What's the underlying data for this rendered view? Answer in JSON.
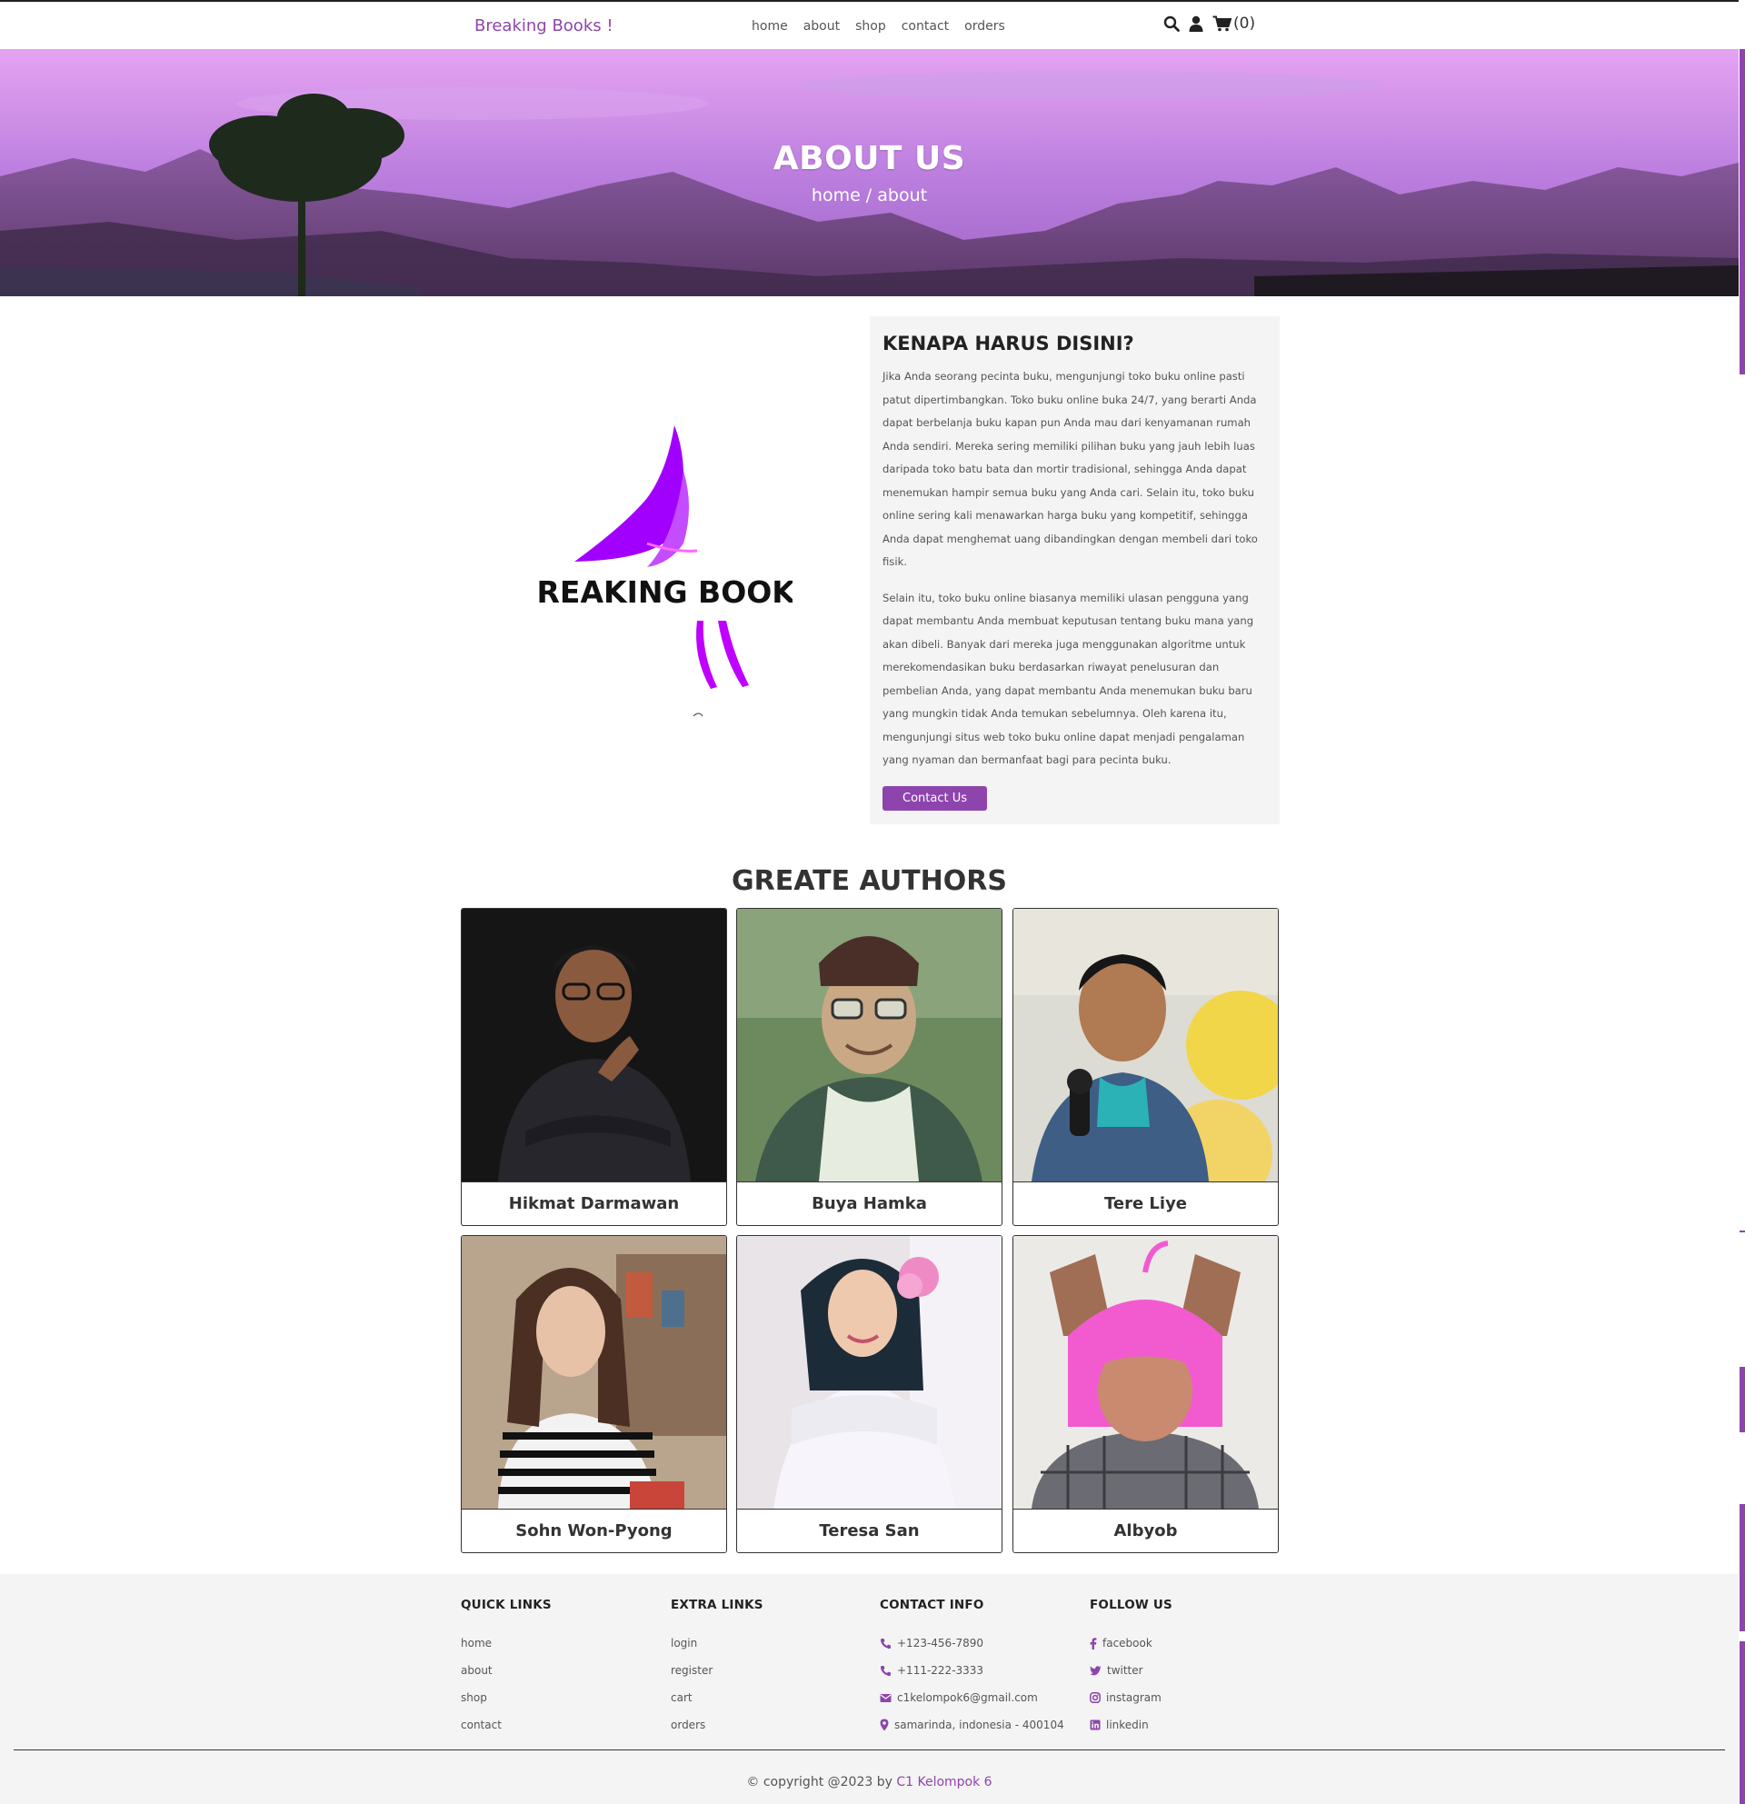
{
  "header": {
    "brand": "Breaking Books !",
    "nav": [
      "home",
      "about",
      "shop",
      "contact",
      "orders"
    ],
    "cart_count": "(0)",
    "icons": [
      "search-icon",
      "user-icon",
      "cart-icon"
    ]
  },
  "hero": {
    "title": "ABOUT US",
    "breadcrumb": "home / about"
  },
  "about": {
    "logo_text": "BREAKING BOOKS",
    "heading": "KENAPA HARUS DISINI?",
    "paragraph1": "Jika Anda seorang pecinta buku, mengunjungi toko buku online pasti patut dipertimbangkan. Toko buku online buka 24/7, yang berarti Anda dapat berbelanja buku kapan pun Anda mau dari kenyamanan rumah Anda sendiri. Mereka sering memiliki pilihan buku yang jauh lebih luas daripada toko batu bata dan mortir tradisional, sehingga Anda dapat menemukan hampir semua buku yang Anda cari. Selain itu, toko buku online sering kali menawarkan harga buku yang kompetitif, sehingga Anda dapat menghemat uang dibandingkan dengan membeli dari toko fisik.",
    "paragraph2": "Selain itu, toko buku online biasanya memiliki ulasan pengguna yang dapat membantu Anda membuat keputusan tentang buku mana yang akan dibeli. Banyak dari mereka juga menggunakan algoritme untuk merekomendasikan buku berdasarkan riwayat penelusuran dan pembelian Anda, yang dapat membantu Anda menemukan buku baru yang mungkin tidak Anda temukan sebelumnya. Oleh karena itu, mengunjungi situs web toko buku online dapat menjadi pengalaman yang nyaman dan bermanfaat bagi para pecinta buku.",
    "button": "Contact Us"
  },
  "authors": {
    "title": "GREATE AUTHORS",
    "list": [
      {
        "name": "Hikmat Darmawan"
      },
      {
        "name": "Buya Hamka"
      },
      {
        "name": "Tere Liye"
      },
      {
        "name": "Sohn Won-Pyong"
      },
      {
        "name": "Teresa San"
      },
      {
        "name": "Albyob"
      }
    ]
  },
  "footer": {
    "quick_links": {
      "title": "QUICK LINKS",
      "items": [
        "home",
        "about",
        "shop",
        "contact"
      ]
    },
    "extra_links": {
      "title": "EXTRA LINKS",
      "items": [
        "login",
        "register",
        "cart",
        "orders"
      ]
    },
    "contact_info": {
      "title": "CONTACT INFO",
      "items": [
        "+123-456-7890",
        "+111-222-3333",
        "c1kelompok6@gmail.com",
        "samarinda, indonesia - 400104"
      ]
    },
    "follow_us": {
      "title": "FOLLOW US",
      "items": [
        "facebook",
        "twitter",
        "instagram",
        "linkedin"
      ]
    },
    "copyright": "© copyright @2023 by",
    "credit": "C1 Kelompok 6"
  },
  "colors": {
    "accent": "#8e44ad",
    "footer_bg": "#f4f4f4",
    "about_box_bg": "#f4f4f4"
  }
}
